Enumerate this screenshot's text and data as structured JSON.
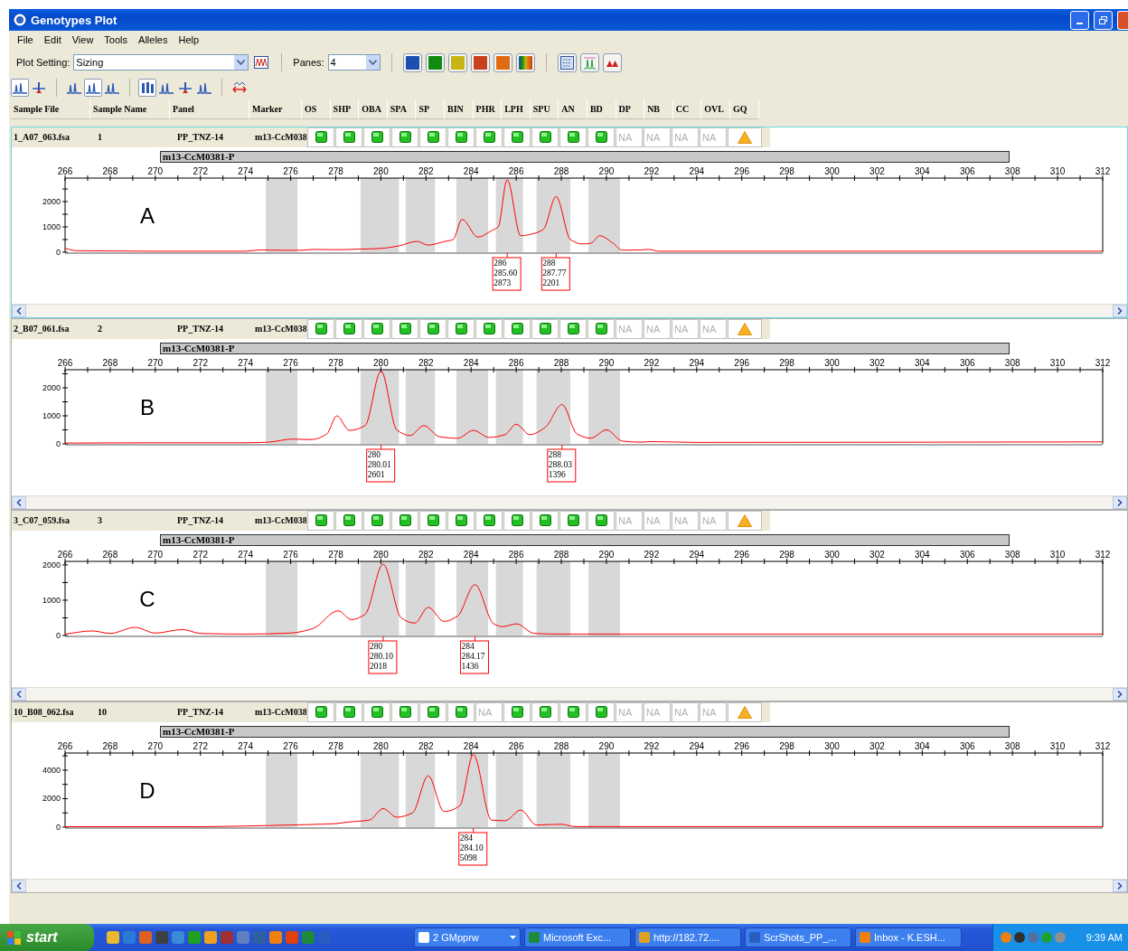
{
  "window": {
    "title": "Genotypes Plot"
  },
  "menu": [
    "File",
    "Edit",
    "View",
    "Tools",
    "Alleles",
    "Help"
  ],
  "toolbar": {
    "plot_setting": {
      "label": "Plot Setting:",
      "value": "Sizing"
    },
    "panes": {
      "label": "Panes:",
      "value": "4"
    },
    "color_buttons": [
      {
        "kind": "solid",
        "color": "#1c4fb0"
      },
      {
        "kind": "solid",
        "color": "#108a10"
      },
      {
        "kind": "solid",
        "color": "#c8b414"
      },
      {
        "kind": "solid",
        "color": "#c8401c"
      },
      {
        "kind": "solid",
        "color": "#e06a10"
      },
      {
        "kind": "gradient"
      }
    ],
    "view_groups": [
      [
        {
          "kind": "peaks",
          "selected": true
        },
        {
          "kind": "marker",
          "selected": false
        }
      ],
      [
        {
          "kind": "peaks",
          "selected": false
        },
        {
          "kind": "peaks",
          "selected": true
        },
        {
          "kind": "peaks",
          "selected": false
        }
      ],
      [
        {
          "kind": "bars",
          "selected": true
        },
        {
          "kind": "peaks",
          "selected": false
        },
        {
          "kind": "marker",
          "selected": false
        },
        {
          "kind": "peaks",
          "selected": false
        }
      ],
      [
        {
          "kind": "arrows",
          "selected": false
        }
      ]
    ]
  },
  "columns": [
    "Sample File",
    "Sample Name",
    "Panel",
    "Marker",
    "OS",
    "SHP",
    "OBA",
    "SPA",
    "SP",
    "BIN",
    "PHR",
    "LPH",
    "SPU",
    "AN",
    "BD",
    "DP",
    "NB",
    "CC",
    "OVL",
    "GQ"
  ],
  "panes": [
    {
      "selected": true,
      "sample_file": "1_A07_063.fsa",
      "sample_name": "1",
      "panel": "PP_TNZ-14",
      "marker": "m13-CcM038",
      "flags": [
        {
          "kind": "ok"
        },
        {
          "kind": "ok"
        },
        {
          "kind": "ok"
        },
        {
          "kind": "ok"
        },
        {
          "kind": "ok"
        },
        {
          "kind": "ok"
        },
        {
          "kind": "ok"
        },
        {
          "kind": "ok"
        },
        {
          "kind": "ok"
        },
        {
          "kind": "ok"
        },
        {
          "kind": "ok"
        },
        {
          "kind": "na",
          "label": "NA"
        },
        {
          "kind": "na",
          "label": "NA"
        },
        {
          "kind": "na",
          "label": "NA"
        },
        {
          "kind": "na",
          "label": "NA"
        },
        {
          "kind": "warn"
        }
      ],
      "marker_bar": "m13-CcM0381-P",
      "letter": "A",
      "chart_data": {
        "type": "line",
        "xlim": [
          266,
          312
        ],
        "ylim": [
          0,
          2930
        ],
        "xticks": [
          266,
          268,
          270,
          272,
          274,
          276,
          278,
          280,
          282,
          284,
          286,
          288,
          290,
          292,
          294,
          296,
          298,
          300,
          302,
          304,
          306,
          308,
          310,
          312
        ],
        "yticks": [
          0,
          1000,
          2000
        ],
        "x": [
          266,
          266.5,
          268,
          270,
          272,
          274,
          274.6,
          275.5,
          276.5,
          277,
          278,
          279,
          280,
          280.8,
          281.6,
          282.1,
          282.8,
          283.2,
          283.6,
          284.3,
          284.9,
          285.2,
          285.6,
          286.2,
          286.7,
          287.2,
          287.77,
          288.4,
          288.9,
          289.3,
          289.7,
          290.3,
          290.7,
          291.5,
          291.9,
          292.3,
          294,
          300,
          306,
          312
        ],
        "series": [
          {
            "color": "#ff0000",
            "values": [
              150,
              60,
              50,
              40,
              40,
              40,
              90,
              80,
              80,
              110,
              100,
              120,
              150,
              250,
              430,
              280,
              420,
              500,
              1300,
              600,
              850,
              1000,
              2870,
              650,
              720,
              900,
              2200,
              500,
              330,
              350,
              650,
              350,
              80,
              90,
              110,
              40,
              40,
              40,
              40,
              40
            ]
          }
        ],
        "bands": [
          {
            "axis": "x",
            "from": 274.9,
            "to": 276.3
          },
          {
            "axis": "x",
            "from": 279.1,
            "to": 280.8
          },
          {
            "axis": "x",
            "from": 281.1,
            "to": 282.4
          },
          {
            "axis": "x",
            "from": 283.35,
            "to": 284.75
          },
          {
            "axis": "x",
            "from": 285.1,
            "to": 286.3
          },
          {
            "axis": "x",
            "from": 286.9,
            "to": 288.4
          },
          {
            "axis": "x",
            "from": 289.2,
            "to": 290.6
          }
        ],
        "annotations": [
          {
            "x": 285.6,
            "text": "286\n285.60\n2873"
          },
          {
            "x": 287.77,
            "text": "288\n287.77\n2201"
          }
        ]
      }
    },
    {
      "selected": false,
      "sample_file": "2_B07_061.fsa",
      "sample_name": "2",
      "panel": "PP_TNZ-14",
      "marker": "m13-CcM038",
      "flags": [
        {
          "kind": "ok"
        },
        {
          "kind": "ok"
        },
        {
          "kind": "ok"
        },
        {
          "kind": "ok"
        },
        {
          "kind": "ok"
        },
        {
          "kind": "ok"
        },
        {
          "kind": "ok"
        },
        {
          "kind": "ok"
        },
        {
          "kind": "ok"
        },
        {
          "kind": "ok"
        },
        {
          "kind": "ok"
        },
        {
          "kind": "na",
          "label": "NA"
        },
        {
          "kind": "na",
          "label": "NA"
        },
        {
          "kind": "na",
          "label": "NA"
        },
        {
          "kind": "na",
          "label": "NA"
        },
        {
          "kind": "warn"
        }
      ],
      "marker_bar": "m13-CcM0381-P",
      "letter": "B",
      "chart_data": {
        "type": "line",
        "xlim": [
          266,
          312
        ],
        "ylim": [
          0,
          2645
        ],
        "xticks": [
          266,
          268,
          270,
          272,
          274,
          276,
          278,
          280,
          282,
          284,
          286,
          288,
          290,
          292,
          294,
          296,
          298,
          300,
          302,
          304,
          306,
          308,
          310,
          312
        ],
        "yticks": [
          0,
          1000,
          2000
        ],
        "x": [
          266,
          270,
          274,
          275,
          276.1,
          276.9,
          277.6,
          278.05,
          278.6,
          279.3,
          280.01,
          280.7,
          281.3,
          281.9,
          282.6,
          283.4,
          284.1,
          284.8,
          285.5,
          286.0,
          286.6,
          287.3,
          288.03,
          288.7,
          289.3,
          290.0,
          290.7,
          291.5,
          292,
          294,
          312
        ],
        "series": [
          {
            "color": "#ff0000",
            "values": [
              30,
              40,
              40,
              60,
              170,
              150,
              350,
              1000,
              480,
              650,
              2600,
              500,
              300,
              650,
              250,
              200,
              480,
              230,
              330,
              700,
              330,
              600,
              1400,
              350,
              200,
              500,
              100,
              60,
              80,
              50,
              70
            ]
          }
        ],
        "bands": [
          {
            "axis": "x",
            "from": 274.9,
            "to": 276.3
          },
          {
            "axis": "x",
            "from": 279.1,
            "to": 280.8
          },
          {
            "axis": "x",
            "from": 281.1,
            "to": 282.4
          },
          {
            "axis": "x",
            "from": 283.35,
            "to": 284.75
          },
          {
            "axis": "x",
            "from": 285.1,
            "to": 286.3
          },
          {
            "axis": "x",
            "from": 286.9,
            "to": 288.4
          },
          {
            "axis": "x",
            "from": 289.2,
            "to": 290.6
          }
        ],
        "annotations": [
          {
            "x": 280.01,
            "text": "280\n280.01\n2601"
          },
          {
            "x": 288.03,
            "text": "288\n288.03\n1396"
          }
        ]
      }
    },
    {
      "selected": false,
      "sample_file": "3_C07_059.fsa",
      "sample_name": "3",
      "panel": "PP_TNZ-14",
      "marker": "m13-CcM038",
      "flags": [
        {
          "kind": "ok"
        },
        {
          "kind": "ok"
        },
        {
          "kind": "ok"
        },
        {
          "kind": "ok"
        },
        {
          "kind": "ok"
        },
        {
          "kind": "ok"
        },
        {
          "kind": "ok"
        },
        {
          "kind": "ok"
        },
        {
          "kind": "ok"
        },
        {
          "kind": "ok"
        },
        {
          "kind": "ok"
        },
        {
          "kind": "na",
          "label": "NA"
        },
        {
          "kind": "na",
          "label": "NA"
        },
        {
          "kind": "na",
          "label": "NA"
        },
        {
          "kind": "na",
          "label": "NA"
        },
        {
          "kind": "warn"
        }
      ],
      "marker_bar": "m13-CcM0381-P",
      "letter": "C",
      "chart_data": {
        "type": "line",
        "xlim": [
          266,
          312
        ],
        "ylim": [
          0,
          2100
        ],
        "xticks": [
          266,
          268,
          270,
          272,
          274,
          276,
          278,
          280,
          282,
          284,
          286,
          288,
          290,
          292,
          294,
          296,
          298,
          300,
          302,
          304,
          306,
          308,
          310,
          312
        ],
        "yticks": [
          0,
          1000,
          2000
        ],
        "x": [
          266,
          267.2,
          268,
          269.1,
          270,
          271.2,
          272,
          274,
          276,
          277,
          278.1,
          278.7,
          279.3,
          280.1,
          280.9,
          281.5,
          282.1,
          282.8,
          283.4,
          284.17,
          285,
          285.4,
          286.0,
          286.8,
          288,
          312
        ],
        "series": [
          {
            "color": "#ff0000",
            "values": [
              40,
              130,
              60,
              230,
              70,
              170,
              60,
              40,
              70,
              200,
              700,
              450,
              600,
              2020,
              500,
              350,
              800,
              400,
              550,
              1440,
              330,
              250,
              330,
              60,
              40,
              40
            ]
          }
        ],
        "bands": [
          {
            "axis": "x",
            "from": 274.9,
            "to": 276.3
          },
          {
            "axis": "x",
            "from": 279.1,
            "to": 280.8
          },
          {
            "axis": "x",
            "from": 281.1,
            "to": 282.4
          },
          {
            "axis": "x",
            "from": 283.35,
            "to": 284.75
          },
          {
            "axis": "x",
            "from": 285.1,
            "to": 286.3
          },
          {
            "axis": "x",
            "from": 286.9,
            "to": 288.4
          },
          {
            "axis": "x",
            "from": 289.2,
            "to": 290.6
          }
        ],
        "annotations": [
          {
            "x": 280.1,
            "text": "280\n280.10\n2018"
          },
          {
            "x": 284.17,
            "text": "284\n284.17\n1436"
          }
        ]
      }
    },
    {
      "selected": false,
      "sample_file": "10_B08_062.fsa",
      "sample_name": "10",
      "panel": "PP_TNZ-14",
      "marker": "m13-CcM038",
      "flags": [
        {
          "kind": "ok"
        },
        {
          "kind": "ok"
        },
        {
          "kind": "ok"
        },
        {
          "kind": "ok"
        },
        {
          "kind": "ok"
        },
        {
          "kind": "ok"
        },
        {
          "kind": "na",
          "label": "NA"
        },
        {
          "kind": "ok"
        },
        {
          "kind": "ok"
        },
        {
          "kind": "ok"
        },
        {
          "kind": "ok"
        },
        {
          "kind": "na",
          "label": "NA"
        },
        {
          "kind": "na",
          "label": "NA"
        },
        {
          "kind": "na",
          "label": "NA"
        },
        {
          "kind": "na",
          "label": "NA"
        },
        {
          "kind": "warn"
        }
      ],
      "marker_bar": "m13-CcM0381-P",
      "letter": "D",
      "chart_data": {
        "type": "line",
        "xlim": [
          266,
          312
        ],
        "ylim": [
          0,
          5200
        ],
        "xticks": [
          266,
          268,
          270,
          272,
          274,
          276,
          278,
          280,
          282,
          284,
          286,
          288,
          290,
          292,
          294,
          296,
          298,
          300,
          302,
          304,
          306,
          308,
          310,
          312
        ],
        "yticks": [
          0,
          2000,
          4000
        ],
        "x": [
          266,
          272,
          274,
          276,
          278,
          278.5,
          279.5,
          280.1,
          280.7,
          281.4,
          282.1,
          282.8,
          283.5,
          284.1,
          284.9,
          285.5,
          286.2,
          286.9,
          288,
          288.6,
          290,
          312
        ],
        "series": [
          {
            "color": "#ff0000",
            "values": [
              30,
              30,
              80,
              150,
              250,
              350,
              500,
              1300,
              700,
              1000,
              3600,
              1100,
              1500,
              5100,
              500,
              450,
              1200,
              150,
              200,
              40,
              40,
              40
            ]
          }
        ],
        "bands": [
          {
            "axis": "x",
            "from": 274.9,
            "to": 276.3
          },
          {
            "axis": "x",
            "from": 279.1,
            "to": 280.8
          },
          {
            "axis": "x",
            "from": 281.1,
            "to": 282.4
          },
          {
            "axis": "x",
            "from": 283.35,
            "to": 284.75
          },
          {
            "axis": "x",
            "from": 285.1,
            "to": 286.3
          },
          {
            "axis": "x",
            "from": 286.9,
            "to": 288.4
          },
          {
            "axis": "x",
            "from": 289.2,
            "to": 290.6
          }
        ],
        "annotations": [
          {
            "x": 284.1,
            "text": "284\n284.10\n5098"
          }
        ]
      }
    }
  ],
  "taskbar": {
    "start": "start",
    "quick_launch": [
      {
        "color": "#e8b830"
      },
      {
        "color": "#2a7ad8"
      },
      {
        "color": "#e06020"
      },
      {
        "color": "#404040"
      },
      {
        "color": "#3a8ad8"
      },
      {
        "color": "#20a020"
      },
      {
        "color": "#f0a020"
      },
      {
        "color": "#a03030"
      },
      {
        "color": "#6080c0"
      },
      {
        "color": "#3060a0"
      },
      {
        "color": "#f08010"
      },
      {
        "color": "#e04010"
      },
      {
        "color": "#1d8a3a"
      },
      {
        "color": "#2a5cc0"
      }
    ],
    "tasks": [
      {
        "kind": "group",
        "label": "2 GMpprw",
        "color": "#ffffff"
      },
      {
        "kind": "window",
        "label": "Microsoft Exc...",
        "color": "#1d8a3a"
      },
      {
        "kind": "window",
        "label": "http://182.72....",
        "color": "#e0a020"
      },
      {
        "kind": "window",
        "label": "ScrShots_PP_...",
        "color": "#2a5cc0"
      },
      {
        "kind": "window",
        "label": "Inbox - K.ESH...",
        "color": "#f08010"
      }
    ],
    "tray": [
      {
        "color": "#f08010"
      },
      {
        "color": "#303030"
      },
      {
        "color": "#5070a0"
      },
      {
        "color": "#20a030"
      },
      {
        "color": "#909090"
      }
    ],
    "clock": "9:39 AM"
  }
}
